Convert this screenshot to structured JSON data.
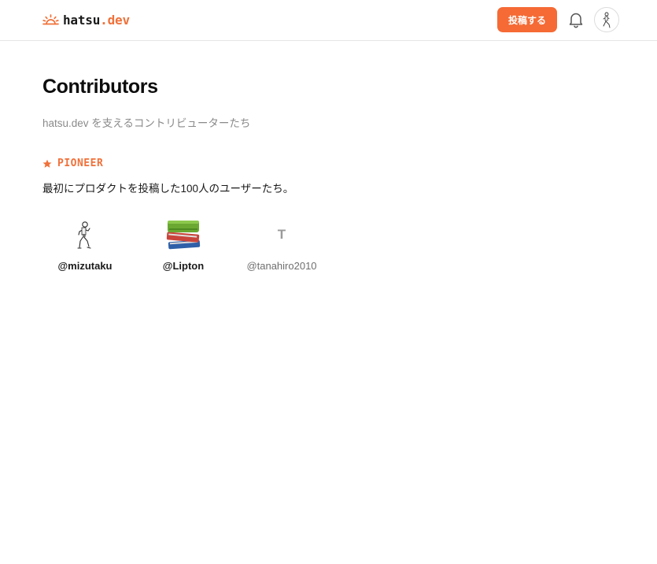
{
  "header": {
    "logo": {
      "part1": "hatsu",
      "dot": ".",
      "part2": "dev"
    },
    "post_button": "投稿する",
    "icons": {
      "logo": "sunrise-icon",
      "notifications": "bell-icon",
      "avatar": "user-avatar"
    }
  },
  "page": {
    "title": "Contributors",
    "subtitle": "hatsu.dev を支えるコントリビューターたち"
  },
  "section": {
    "icon": "star-icon",
    "label": "PIONEER",
    "description": "最初にプロダクトを投稿した100人のユーザーたち。"
  },
  "contributors": [
    {
      "handle": "@mizutaku",
      "avatar": "runner-illustration"
    },
    {
      "handle": "@Lipton",
      "avatar": "books-illustration"
    },
    {
      "handle": "@tanahiro2010",
      "avatar": "initial",
      "initial": "T"
    }
  ],
  "colors": {
    "accent": "#f56a35",
    "brand": "#f0713a",
    "muted": "#8a8a8a",
    "border": "#e6e6e6"
  }
}
